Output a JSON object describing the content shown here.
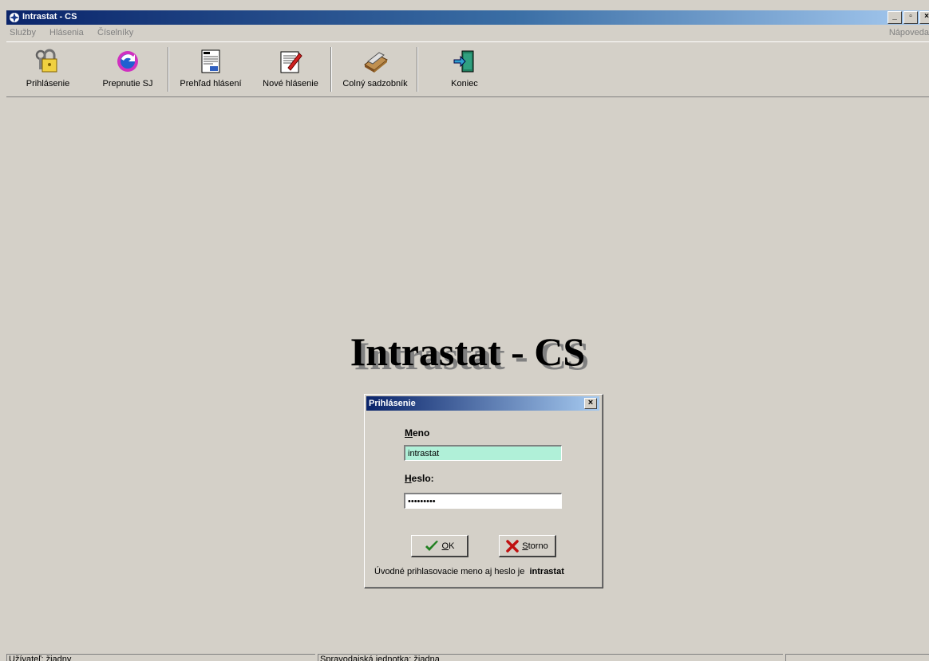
{
  "window": {
    "title": "Intrastat - CS",
    "minimize": "_",
    "restore": "▫",
    "close": "×"
  },
  "menu": {
    "items": [
      "Služby",
      "Hlásenia",
      "Číselníky"
    ],
    "help": "Nápoveda"
  },
  "toolbar": {
    "login": "Prihlásenie",
    "switch": "Prepnutie SJ",
    "overview": "Prehľad hlásení",
    "new_report": "Nové hlásenie",
    "tariff": "Colný sadzobník",
    "exit": "Koniec"
  },
  "heading": "Intrastat - CS",
  "dialog": {
    "title": "Prihlásenie",
    "close": "×",
    "name_label_first": "M",
    "name_label_rest": "eno",
    "name_value": "intrastat",
    "password_label_first": "H",
    "password_label_rest": "eslo:",
    "password_value": "intrastat",
    "ok_first": "O",
    "ok_rest": "K",
    "cancel_first": "S",
    "cancel_rest": "torno",
    "hint_text": "Úvodné prihlasovacie meno aj heslo je",
    "hint_bold": "intrastat"
  },
  "status": {
    "user": "Užívateľ: žiadny",
    "unit": "Spravodajská jednotka: žiadna",
    "extra": ""
  }
}
